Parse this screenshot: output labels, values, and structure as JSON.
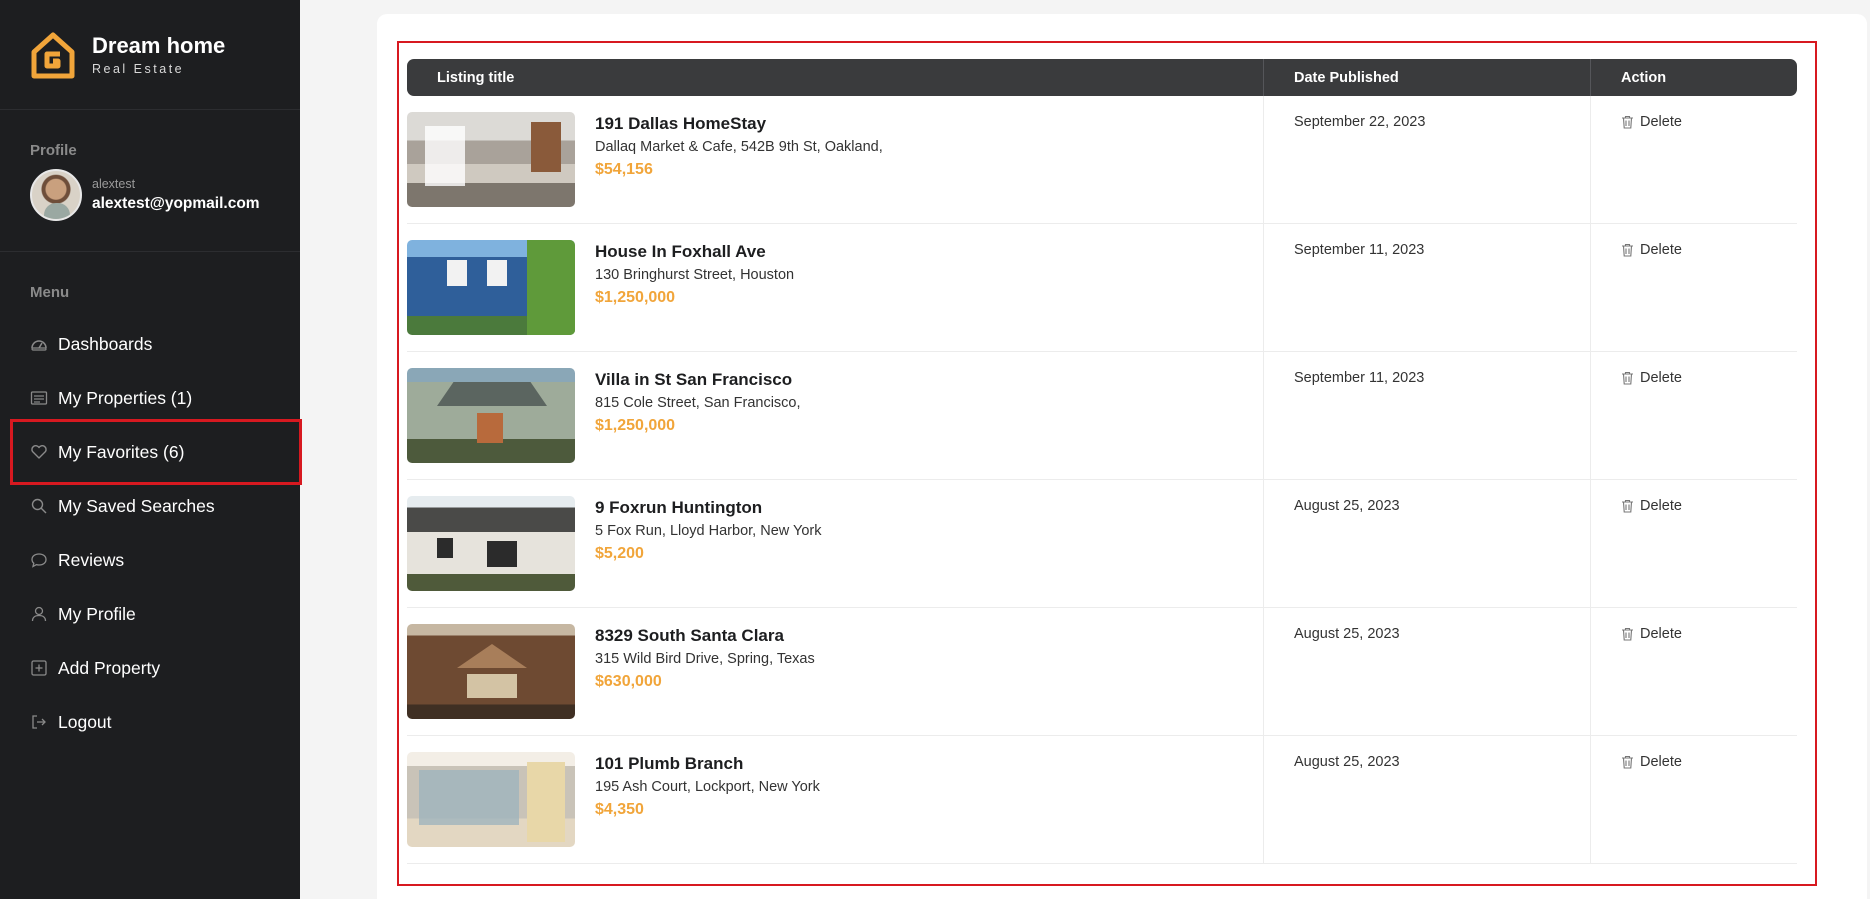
{
  "brand": {
    "name": "Dream home",
    "tagline": "Real Estate",
    "accent": "#f1a53a"
  },
  "sidebar": {
    "profile_label": "Profile",
    "username": "alextest",
    "email": "alextest@yopmail.com",
    "menu_label": "Menu",
    "items": [
      {
        "label": "Dashboards",
        "icon": "dashboard-icon"
      },
      {
        "label": "My Properties (1)",
        "icon": "list-icon"
      },
      {
        "label": "My Favorites (6)",
        "icon": "heart-icon"
      },
      {
        "label": "My Saved Searches",
        "icon": "search-icon"
      },
      {
        "label": "Reviews",
        "icon": "chat-icon"
      },
      {
        "label": "My Profile",
        "icon": "user-icon"
      },
      {
        "label": "Add Property",
        "icon": "plus-square-icon"
      },
      {
        "label": "Logout",
        "icon": "logout-icon"
      }
    ]
  },
  "table": {
    "headers": {
      "title": "Listing title",
      "date": "Date Published",
      "action": "Action"
    },
    "delete_label": "Delete",
    "rows": [
      {
        "title": "191 Dallas HomeStay",
        "address": "Dallaq Market & Cafe, 542B 9th St, Oakland,",
        "price": "$54,156",
        "date": "September 22, 2023"
      },
      {
        "title": "House In Foxhall Ave",
        "address": "130 Bringhurst Street, Houston",
        "price": "$1,250,000",
        "date": "September 11, 2023"
      },
      {
        "title": "Villa in St San Francisco",
        "address": "815 Cole Street, San Francisco,",
        "price": "$1,250,000",
        "date": "September 11, 2023"
      },
      {
        "title": "9 Foxrun Huntington",
        "address": "5 Fox Run, Lloyd Harbor, New York",
        "price": "$5,200",
        "date": "August 25, 2023"
      },
      {
        "title": "8329 South Santa Clara",
        "address": "315 Wild Bird Drive, Spring, Texas",
        "price": "$630,000",
        "date": "August 25, 2023"
      },
      {
        "title": "101 Plumb Branch",
        "address": "195 Ash Court, Lockport, New York",
        "price": "$4,350",
        "date": "August 25, 2023"
      }
    ]
  }
}
